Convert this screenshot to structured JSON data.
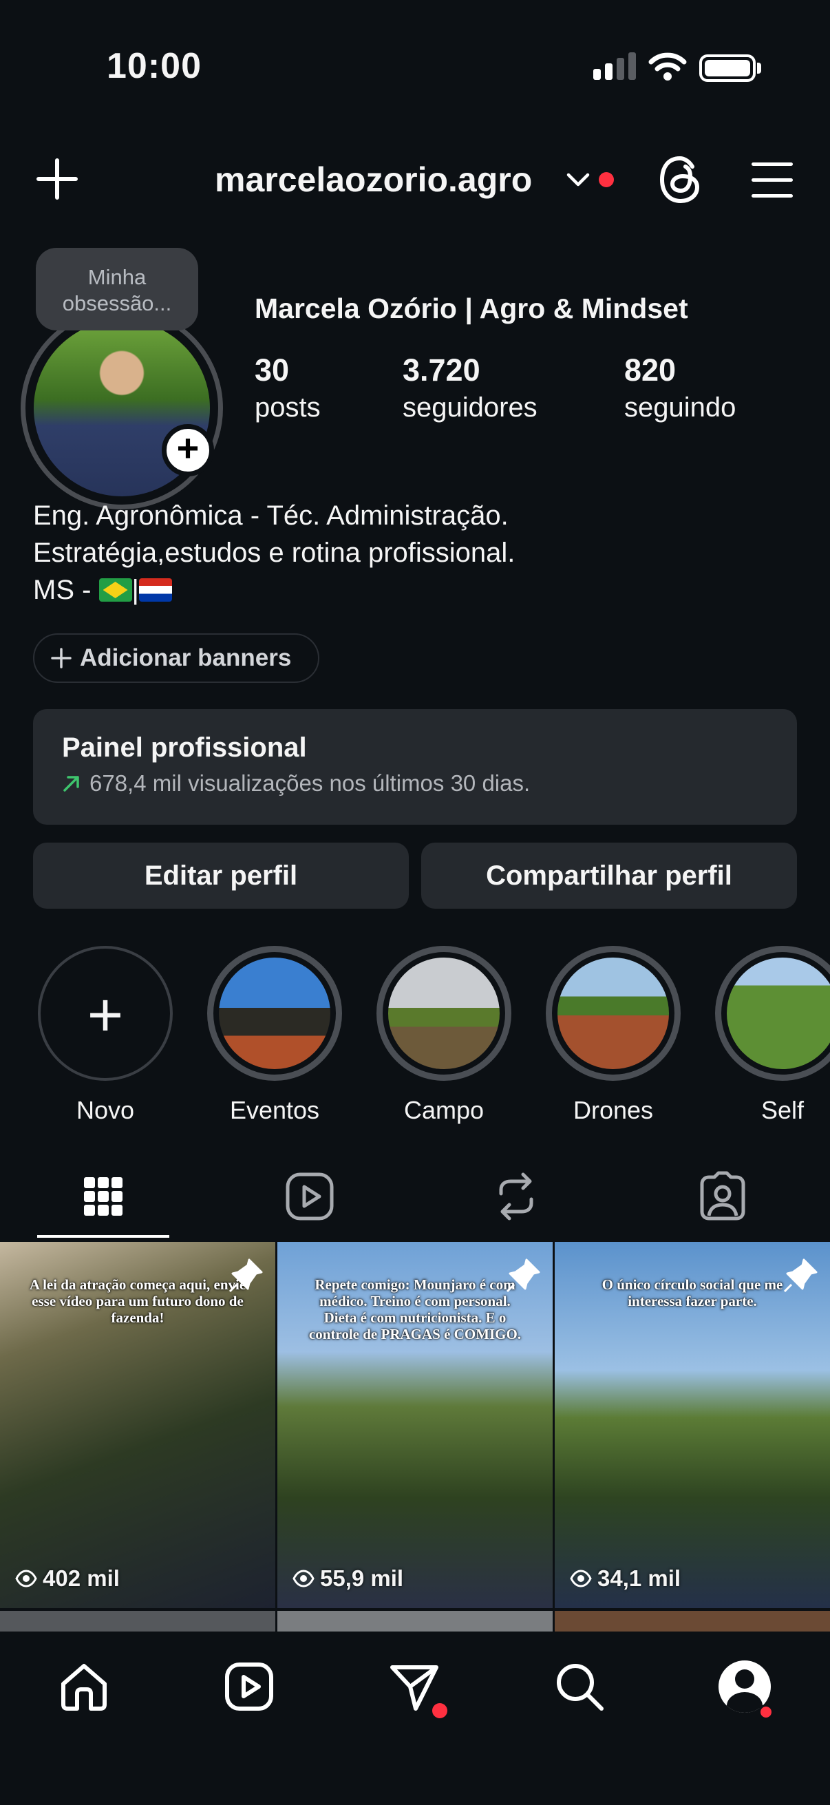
{
  "status_bar": {
    "time": "10:00"
  },
  "header": {
    "username": "marcelaozorio.agro"
  },
  "profile": {
    "note": "Minha obsessão...",
    "full_name": "Marcela Ozório | Agro & Mindset",
    "stats": [
      {
        "value": "30",
        "label": "posts"
      },
      {
        "value": "3.720",
        "label": "seguidores"
      },
      {
        "value": "820",
        "label": "seguindo"
      }
    ],
    "bio": [
      "Eng. Agronômica - Téc. Administração.",
      "Estratégia,estudos e rotina profissional.",
      "MS - "
    ],
    "bio_flags": [
      "Brazil flag",
      "Paraguay flag"
    ],
    "bio_separator": "|"
  },
  "add_banners": "Adicionar banners",
  "professional_panel": {
    "title": "Painel profissional",
    "subtitle": "678,4 mil visualizações nos últimos 30 dias."
  },
  "buttons": {
    "edit_profile": "Editar perfil",
    "share_profile": "Compartilhar perfil"
  },
  "highlights": [
    {
      "label": "Novo",
      "icon": "plus-icon"
    },
    {
      "label": "Eventos"
    },
    {
      "label": "Campo"
    },
    {
      "label": "Drones"
    },
    {
      "label": "Self"
    }
  ],
  "tabs": [
    "grid-icon",
    "reels-icon",
    "reposts-icon",
    "tagged-icon"
  ],
  "posts": [
    {
      "caption": "A lei da atração começa aqui, envie esse vídeo para um futuro dono de fazenda!",
      "views": "402 mil",
      "pinned": true
    },
    {
      "caption": "Repete comigo: Mounjaro é com médico. Treino é com personal. Dieta é com nutricionista. E o controle de PRAGAS é COMIGO.",
      "views": "55,9 mil",
      "pinned": true
    },
    {
      "caption": "O único círculo social que me interessa fazer parte.",
      "views": "34,1 mil",
      "pinned": true
    }
  ],
  "bottom_nav": [
    "home-icon",
    "reels-icon",
    "direct-icon",
    "search-icon",
    "profile-icon"
  ],
  "colors": {
    "background": "#0c1014",
    "card": "#25292e",
    "notification": "#ff3040",
    "trend": "#3ec46d"
  }
}
